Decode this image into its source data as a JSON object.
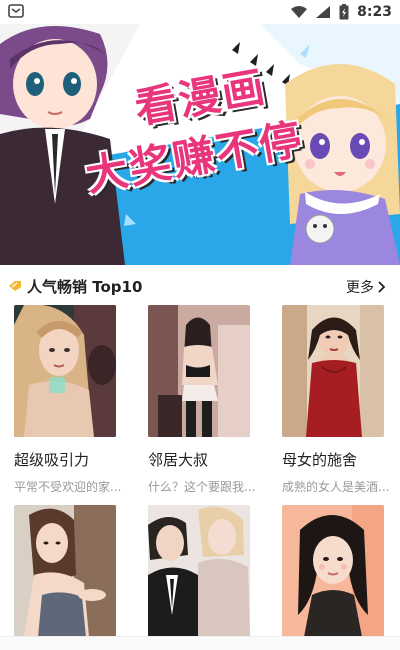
{
  "status_bar": {
    "time": "8:23"
  },
  "banner": {
    "line1": "看漫画",
    "line2": "大奖赚不停"
  },
  "section": {
    "title": "人气畅销 Top10",
    "more_label": "更多"
  },
  "comics": [
    {
      "title": "超级吸引力",
      "desc": "平常不受欢迎的家..."
    },
    {
      "title": "邻居大叔",
      "desc": "什么？这个要跟我..."
    },
    {
      "title": "母女的施舍",
      "desc": "成熟的女人是美酒..."
    },
    {
      "title": "",
      "desc": ""
    },
    {
      "title": "",
      "desc": ""
    },
    {
      "title": "",
      "desc": ""
    }
  ],
  "colors": {
    "accent_pink": "#e8357c",
    "banner_blue": "#2aa7e8",
    "text_gray": "#999999"
  }
}
